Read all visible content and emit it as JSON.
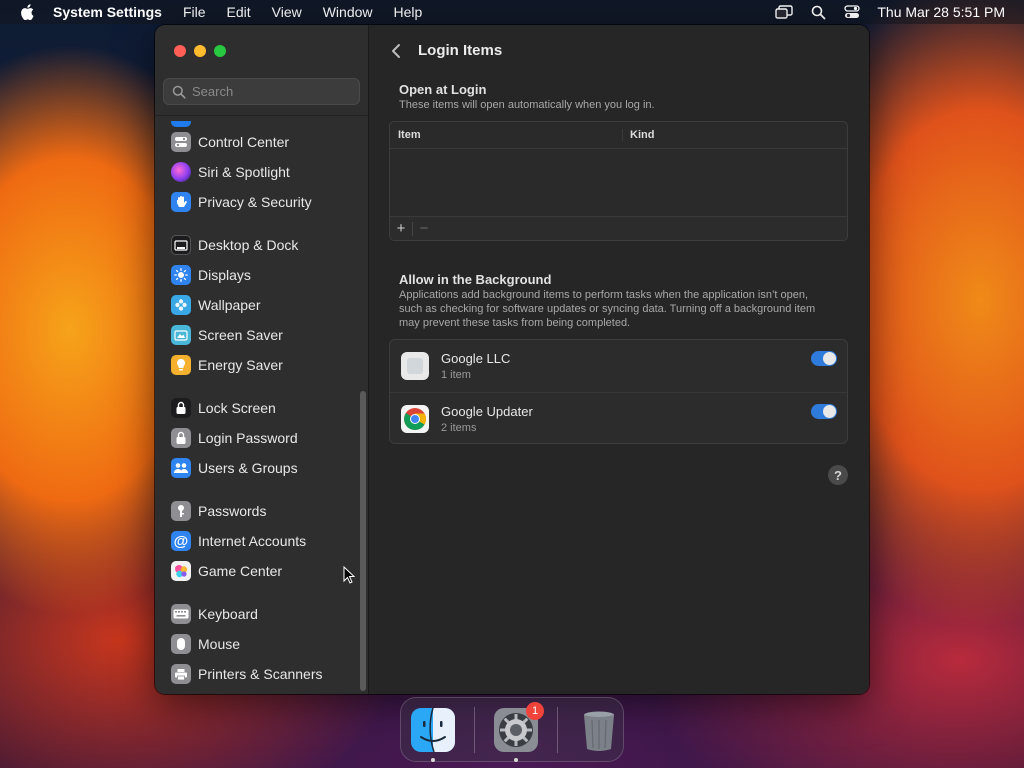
{
  "menubar": {
    "app_name": "System Settings",
    "menus": [
      "File",
      "Edit",
      "View",
      "Window",
      "Help"
    ],
    "clock": "Thu Mar 28  5:51 PM"
  },
  "sidebar": {
    "search_placeholder": "Search",
    "groups": [
      [
        {
          "label": "Control Center",
          "icon": "control-center-icon",
          "color": "#8e8e93"
        },
        {
          "label": "Siri & Spotlight",
          "icon": "siri-icon",
          "color": "#b84bd6"
        },
        {
          "label": "Privacy & Security",
          "icon": "hand-icon",
          "color": "#2f84f0"
        }
      ],
      [
        {
          "label": "Desktop & Dock",
          "icon": "dock-icon",
          "color": "#1c1c1e"
        },
        {
          "label": "Displays",
          "icon": "sun-icon",
          "color": "#2f84f0"
        },
        {
          "label": "Wallpaper",
          "icon": "flower-icon",
          "color": "#3aa8e6"
        },
        {
          "label": "Screen Saver",
          "icon": "screen-saver-icon",
          "color": "#49b7d8"
        },
        {
          "label": "Energy Saver",
          "icon": "bulb-icon",
          "color": "#f5b02e"
        }
      ],
      [
        {
          "label": "Lock Screen",
          "icon": "lock-icon",
          "color": "#1c1c1e"
        },
        {
          "label": "Login Password",
          "icon": "lock-icon",
          "color": "#8e8e93"
        },
        {
          "label": "Users & Groups",
          "icon": "users-icon",
          "color": "#2f84f0"
        }
      ],
      [
        {
          "label": "Passwords",
          "icon": "key-icon",
          "color": "#8e8e93"
        },
        {
          "label": "Internet Accounts",
          "icon": "at-icon",
          "color": "#2f84f0"
        },
        {
          "label": "Game Center",
          "icon": "game-center-icon",
          "color": "#f2f2f2"
        }
      ],
      [
        {
          "label": "Keyboard",
          "icon": "keyboard-icon",
          "color": "#8e8e93"
        },
        {
          "label": "Mouse",
          "icon": "mouse-icon",
          "color": "#8e8e93"
        },
        {
          "label": "Printers & Scanners",
          "icon": "printer-icon",
          "color": "#8e8e93"
        }
      ]
    ]
  },
  "main": {
    "title": "Login Items",
    "open_at_login": {
      "title": "Open at Login",
      "subtitle": "These items will open automatically when you log in.",
      "col_item": "Item",
      "col_kind": "Kind",
      "add": "+",
      "remove": "−"
    },
    "background": {
      "title": "Allow in the Background",
      "description": "Applications add background items to perform tasks when the application isn’t open, such as checking for software updates or syncing data. Turning off a background item may prevent these tasks from being completed.",
      "items": [
        {
          "name": "Google LLC",
          "count": "1 item",
          "enabled": true
        },
        {
          "name": "Google Updater",
          "count": "2 items",
          "enabled": true
        }
      ]
    },
    "help": "?"
  },
  "dock": {
    "badge": "1"
  },
  "colors": {
    "accent": "#2f7bdc",
    "close": "#ff5f57",
    "minimize": "#febc2e",
    "zoom": "#28c840"
  }
}
